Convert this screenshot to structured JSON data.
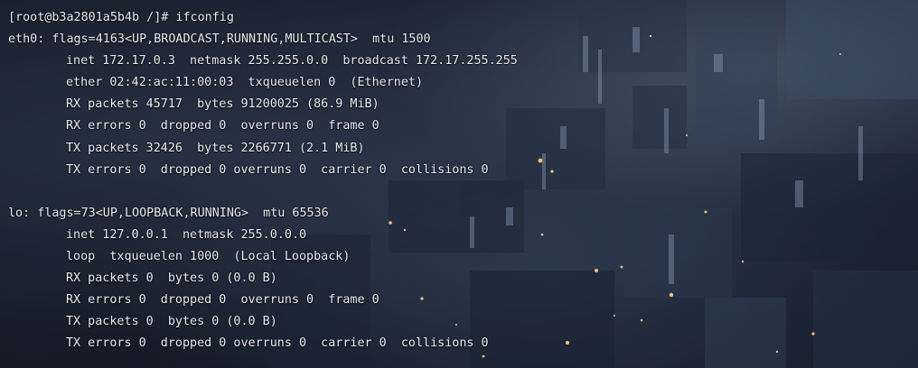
{
  "terminal": {
    "prompt": "[root@b3a2801a5b4b /]# ifconfig",
    "eth0": {
      "header": "eth0: flags=4163<UP,BROADCAST,RUNNING,MULTICAST>  mtu 1500",
      "inet": "inet 172.17.0.3  netmask 255.255.0.0  broadcast 172.17.255.255",
      "ether": "ether 02:42:ac:11:00:03  txqueuelen 0  (Ethernet)",
      "rx_packets": "RX packets 45717  bytes 91200025 (86.9 MiB)",
      "rx_errors": "RX errors 0  dropped 0  overruns 0  frame 0",
      "tx_packets": "TX packets 32426  bytes 2266771 (2.1 MiB)",
      "tx_errors": "TX errors 0  dropped 0 overruns 0  carrier 0  collisions 0"
    },
    "lo": {
      "header": "lo: flags=73<UP,LOOPBACK,RUNNING>  mtu 65536",
      "inet": "inet 127.0.0.1  netmask 255.0.0.0",
      "loop": "loop  txqueuelen 1000  (Local Loopback)",
      "rx_packets": "RX packets 0  bytes 0 (0.0 B)",
      "rx_errors": "RX errors 0  dropped 0  overruns 0  frame 0",
      "tx_packets": "TX packets 0  bytes 0 (0.0 B)",
      "tx_errors": "TX errors 0  dropped 0 overruns 0  carrier 0  collisions 0"
    }
  }
}
